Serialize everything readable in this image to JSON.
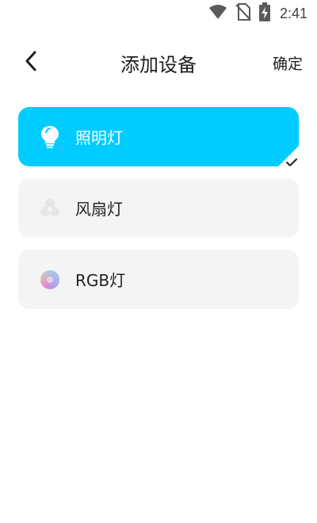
{
  "status_bar": {
    "time": "2:41",
    "icons": [
      "wifi-icon",
      "no-sim-icon",
      "battery-charging-icon"
    ]
  },
  "header": {
    "back_icon": "chevron-left-icon",
    "title": "添加设备",
    "confirm_label": "确定"
  },
  "devices": [
    {
      "label": "照明灯",
      "icon": "bulb-icon",
      "selected": true
    },
    {
      "label": "风扇灯",
      "icon": "fan-icon",
      "selected": false
    },
    {
      "label": "RGB灯",
      "icon": "rgb-color-wheel-icon",
      "selected": false
    }
  ],
  "colors": {
    "selected_bg": "#00ccff",
    "card_bg": "#f4f4f4",
    "text": "#1f1f1f"
  }
}
